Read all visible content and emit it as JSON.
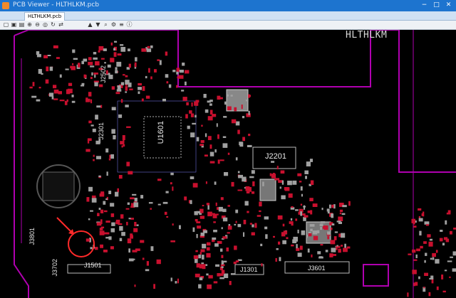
{
  "window": {
    "title": "PCB Viewer - HLTHLKM.pcb",
    "buttons": [
      "−",
      "□",
      "✕"
    ]
  },
  "tabs": [
    {
      "label": "HLTHLKM.pcb"
    }
  ],
  "toolbar": {
    "icons": [
      "open-icon",
      "save-icon",
      "print-icon",
      "zoom-in-icon",
      "zoom-out-icon",
      "zoom-fit-icon",
      "rotate-icon",
      "flip-icon",
      "layer-top-icon",
      "layer-bottom-icon",
      "find-icon",
      "settings-icon",
      "net-icon",
      "info-icon"
    ]
  },
  "board": {
    "label": "HLTHLKM",
    "refs": {
      "u1601": "U1601",
      "j2201": "J2201",
      "j1301": "J1301",
      "j3601": "J3601",
      "j2301": "J2301",
      "j2502": "J2502",
      "j1501": "J1501",
      "j3801": "J3801",
      "j3702": "J3702"
    }
  },
  "colors": {
    "outline": "#b000b0",
    "pad_red": "#c8102e",
    "pad_gray": "#a0a0a0",
    "silk": "#e8e8e8",
    "highlight": "#ff2a2a"
  }
}
